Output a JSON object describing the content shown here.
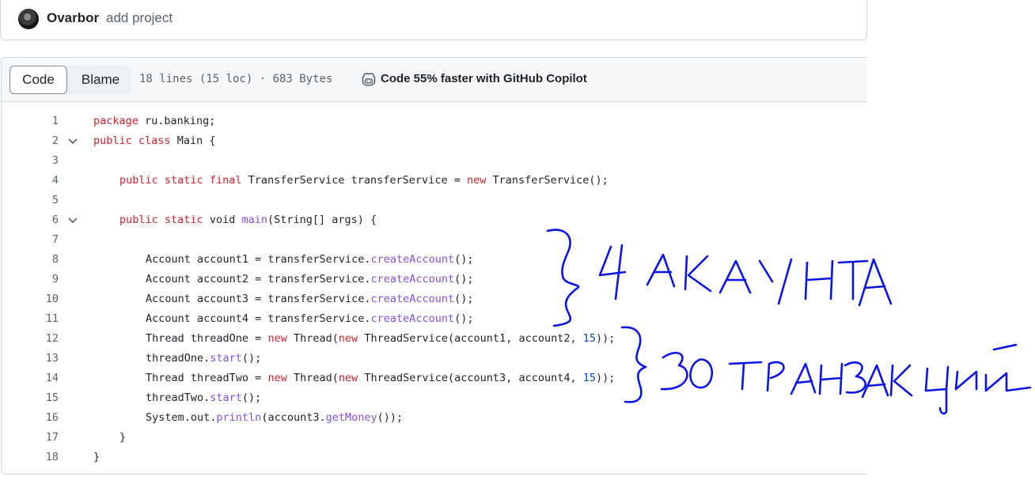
{
  "commit": {
    "author": "Ovarbor",
    "message": "add project"
  },
  "file_header": {
    "tabs": [
      {
        "label": "Code",
        "selected": true
      },
      {
        "label": "Blame",
        "selected": false
      }
    ],
    "info": "18 lines (15 loc) · 683 Bytes",
    "copilot_label": "Code 55% faster with GitHub Copilot"
  },
  "code_lines": [
    {
      "num": "1",
      "fold": false,
      "indent": 0,
      "tokens": [
        [
          "k",
          "package"
        ],
        [
          "p",
          " ru.banking;"
        ]
      ]
    },
    {
      "num": "2",
      "fold": true,
      "indent": 0,
      "tokens": [
        [
          "k",
          "public"
        ],
        [
          "p",
          " "
        ],
        [
          "k",
          "class"
        ],
        [
          "p",
          " Main {"
        ]
      ]
    },
    {
      "num": "3",
      "fold": false,
      "indent": 0,
      "tokens": []
    },
    {
      "num": "4",
      "fold": false,
      "indent": 1,
      "tokens": [
        [
          "k",
          "public"
        ],
        [
          "p",
          " "
        ],
        [
          "k",
          "static"
        ],
        [
          "p",
          " "
        ],
        [
          "k",
          "final"
        ],
        [
          "p",
          " TransferService transferService = "
        ],
        [
          "k",
          "new"
        ],
        [
          "p",
          " TransferService();"
        ]
      ]
    },
    {
      "num": "5",
      "fold": false,
      "indent": 0,
      "tokens": []
    },
    {
      "num": "6",
      "fold": true,
      "indent": 1,
      "tokens": [
        [
          "k",
          "public"
        ],
        [
          "p",
          " "
        ],
        [
          "k",
          "static"
        ],
        [
          "p",
          " void "
        ],
        [
          "f",
          "main"
        ],
        [
          "p",
          "(String[] args) {"
        ]
      ]
    },
    {
      "num": "7",
      "fold": false,
      "indent": 0,
      "tokens": []
    },
    {
      "num": "8",
      "fold": false,
      "indent": 2,
      "tokens": [
        [
          "p",
          "Account account1 = transferService."
        ],
        [
          "f",
          "createAccount"
        ],
        [
          "p",
          "();"
        ]
      ]
    },
    {
      "num": "9",
      "fold": false,
      "indent": 2,
      "tokens": [
        [
          "p",
          "Account account2 = transferService."
        ],
        [
          "f",
          "createAccount"
        ],
        [
          "p",
          "();"
        ]
      ]
    },
    {
      "num": "10",
      "fold": false,
      "indent": 2,
      "tokens": [
        [
          "p",
          "Account account3 = transferService."
        ],
        [
          "f",
          "createAccount"
        ],
        [
          "p",
          "();"
        ]
      ]
    },
    {
      "num": "11",
      "fold": false,
      "indent": 2,
      "tokens": [
        [
          "p",
          "Account account4 = transferService."
        ],
        [
          "f",
          "createAccount"
        ],
        [
          "p",
          "();"
        ]
      ]
    },
    {
      "num": "12",
      "fold": false,
      "indent": 2,
      "caret_after": 10,
      "tokens": [
        [
          "p",
          "Thread threadOne = "
        ],
        [
          "k",
          "new"
        ],
        [
          "p",
          " Thread("
        ],
        [
          "k",
          "new"
        ],
        [
          "p",
          " ThreadService(account1, account2, "
        ],
        [
          "n",
          "15"
        ],
        [
          "p",
          ")"
        ],
        [
          "p",
          ");"
        ]
      ]
    },
    {
      "num": "13",
      "fold": false,
      "indent": 2,
      "tokens": [
        [
          "p",
          "threadOne."
        ],
        [
          "f",
          "start"
        ],
        [
          "p",
          "();"
        ]
      ]
    },
    {
      "num": "14",
      "fold": false,
      "indent": 2,
      "tokens": [
        [
          "p",
          "Thread threadTwo = "
        ],
        [
          "k",
          "new"
        ],
        [
          "p",
          " Thread("
        ],
        [
          "k",
          "new"
        ],
        [
          "p",
          " ThreadService(account3, account4, "
        ],
        [
          "n",
          "15"
        ],
        [
          "p",
          "));"
        ]
      ]
    },
    {
      "num": "15",
      "fold": false,
      "indent": 2,
      "tokens": [
        [
          "p",
          "threadTwo."
        ],
        [
          "f",
          "start"
        ],
        [
          "p",
          "();"
        ]
      ]
    },
    {
      "num": "16",
      "fold": false,
      "indent": 2,
      "tokens": [
        [
          "p",
          "System.out."
        ],
        [
          "f",
          "println"
        ],
        [
          "p",
          "(account3."
        ],
        [
          "f",
          "getMoney"
        ],
        [
          "p",
          "());"
        ]
      ]
    },
    {
      "num": "17",
      "fold": false,
      "indent": 1,
      "tokens": [
        [
          "p",
          "}"
        ]
      ]
    },
    {
      "num": "18",
      "fold": false,
      "indent": 0,
      "tokens": [
        [
          "p",
          "}"
        ]
      ]
    }
  ],
  "handwriting": {
    "ink_color": "#0a14e6",
    "note_top": "4 АКАУНТА",
    "note_bottom": "30 ТРАНЗАКЦИЙ"
  }
}
